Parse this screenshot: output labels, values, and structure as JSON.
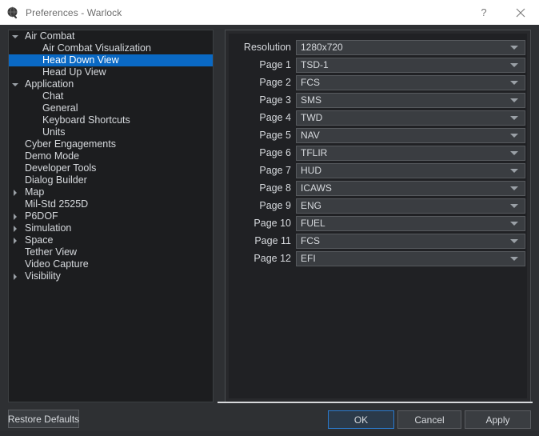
{
  "window": {
    "title": "Preferences - Warlock",
    "icon": "globe-icon",
    "help_label": "?",
    "close_label": "✕"
  },
  "tree": {
    "items": [
      {
        "label": "Air Combat",
        "indent": 0,
        "twisty": "down",
        "selected": false
      },
      {
        "label": "Air Combat Visualization",
        "indent": 1,
        "twisty": "none",
        "selected": false
      },
      {
        "label": "Head Down View",
        "indent": 1,
        "twisty": "none",
        "selected": true
      },
      {
        "label": "Head Up View",
        "indent": 1,
        "twisty": "none",
        "selected": false
      },
      {
        "label": "Application",
        "indent": 0,
        "twisty": "down",
        "selected": false
      },
      {
        "label": "Chat",
        "indent": 1,
        "twisty": "none",
        "selected": false
      },
      {
        "label": "General",
        "indent": 1,
        "twisty": "none",
        "selected": false
      },
      {
        "label": "Keyboard Shortcuts",
        "indent": 1,
        "twisty": "none",
        "selected": false
      },
      {
        "label": "Units",
        "indent": 1,
        "twisty": "none",
        "selected": false
      },
      {
        "label": "Cyber Engagements",
        "indent": 0,
        "twisty": "none",
        "selected": false
      },
      {
        "label": "Demo Mode",
        "indent": 0,
        "twisty": "none",
        "selected": false
      },
      {
        "label": "Developer Tools",
        "indent": 0,
        "twisty": "none",
        "selected": false
      },
      {
        "label": "Dialog Builder",
        "indent": 0,
        "twisty": "none",
        "selected": false
      },
      {
        "label": "Map",
        "indent": 0,
        "twisty": "right",
        "selected": false
      },
      {
        "label": "Mil-Std 2525D",
        "indent": 0,
        "twisty": "none",
        "selected": false
      },
      {
        "label": "P6DOF",
        "indent": 0,
        "twisty": "right",
        "selected": false
      },
      {
        "label": "Simulation",
        "indent": 0,
        "twisty": "right",
        "selected": false
      },
      {
        "label": "Space",
        "indent": 0,
        "twisty": "right",
        "selected": false
      },
      {
        "label": "Tether View",
        "indent": 0,
        "twisty": "none",
        "selected": false
      },
      {
        "label": "Video Capture",
        "indent": 0,
        "twisty": "none",
        "selected": false
      },
      {
        "label": "Visibility",
        "indent": 0,
        "twisty": "right",
        "selected": false
      }
    ]
  },
  "options": {
    "rows": [
      {
        "label": "Resolution",
        "value": "1280x720"
      },
      {
        "label": "Page 1",
        "value": "TSD-1"
      },
      {
        "label": "Page 2",
        "value": "FCS"
      },
      {
        "label": "Page 3",
        "value": "SMS"
      },
      {
        "label": "Page 4",
        "value": "TWD"
      },
      {
        "label": "Page 5",
        "value": "NAV"
      },
      {
        "label": "Page 6",
        "value": "TFLIR"
      },
      {
        "label": "Page 7",
        "value": "HUD"
      },
      {
        "label": "Page 8",
        "value": "ICAWS"
      },
      {
        "label": "Page 9",
        "value": "ENG"
      },
      {
        "label": "Page 10",
        "value": "FUEL"
      },
      {
        "label": "Page 11",
        "value": "FCS"
      },
      {
        "label": "Page 12",
        "value": "EFI"
      }
    ]
  },
  "footer": {
    "restore_defaults": "Restore Defaults",
    "ok": "OK",
    "cancel": "Cancel",
    "apply": "Apply"
  },
  "colors": {
    "selection_blue": "#0a69c4",
    "focus_blue": "#2a7bd0",
    "panel_bg": "#1c1d1f",
    "window_bg": "#2e3033",
    "titlebar_bg": "#ffffff",
    "text": "#d6d9dd"
  }
}
